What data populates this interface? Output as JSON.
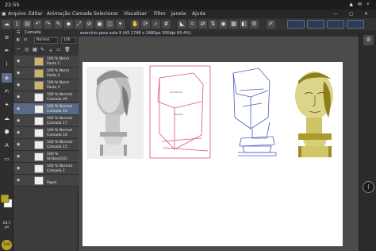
{
  "status": {
    "time": "22:55",
    "icons": "▲ ✉ ⚡"
  },
  "menu": {
    "items": [
      "Arquivo",
      "Editar",
      "Animação",
      "Camada",
      "Selecionar",
      "Visualizar",
      "Filtro",
      "Janela",
      "Ajuda"
    ],
    "window_controls": [
      "—",
      "▢",
      "✕"
    ]
  },
  "layers": {
    "tab_label": "Camada",
    "blend_mode": "Normal",
    "opacity": "100",
    "rows": [
      {
        "name1": "100 % Norm",
        "name2": "Pasta 1",
        "folder": true
      },
      {
        "name1": "100 % Norm",
        "name2": "Pasta 2",
        "folder": true
      },
      {
        "name1": "100 % Norm",
        "name2": "Pasta 3",
        "folder": true
      },
      {
        "name1": "100 % Normal",
        "name2": "Camada 20",
        "folder": false
      },
      {
        "name1": "100 % Normal",
        "name2": "Camada 19",
        "folder": false,
        "selected": true
      },
      {
        "name1": "100 % Normal",
        "name2": "Camada 17",
        "folder": false
      },
      {
        "name1": "100 % Normal",
        "name2": "Camada 16",
        "folder": false
      },
      {
        "name1": "100 % Normal",
        "name2": "Camada 15",
        "folder": false
      },
      {
        "name1": "100 %",
        "name2": "Strikes(0/2)",
        "folder": false
      },
      {
        "name1": "100 % Normal",
        "name2": "Camada 1",
        "folder": false
      },
      {
        "name1": "",
        "name2": "Papel",
        "folder": false
      }
    ]
  },
  "document": {
    "title": "exercício para aula 9 (A5 1748 x 2480px 300dpi 60.4%)"
  },
  "brush": {
    "size_label": "28.7",
    "size_unit": "px",
    "opacity_label": "100"
  },
  "colors": {
    "main": "#b6a420",
    "sub": "#ffffff"
  }
}
